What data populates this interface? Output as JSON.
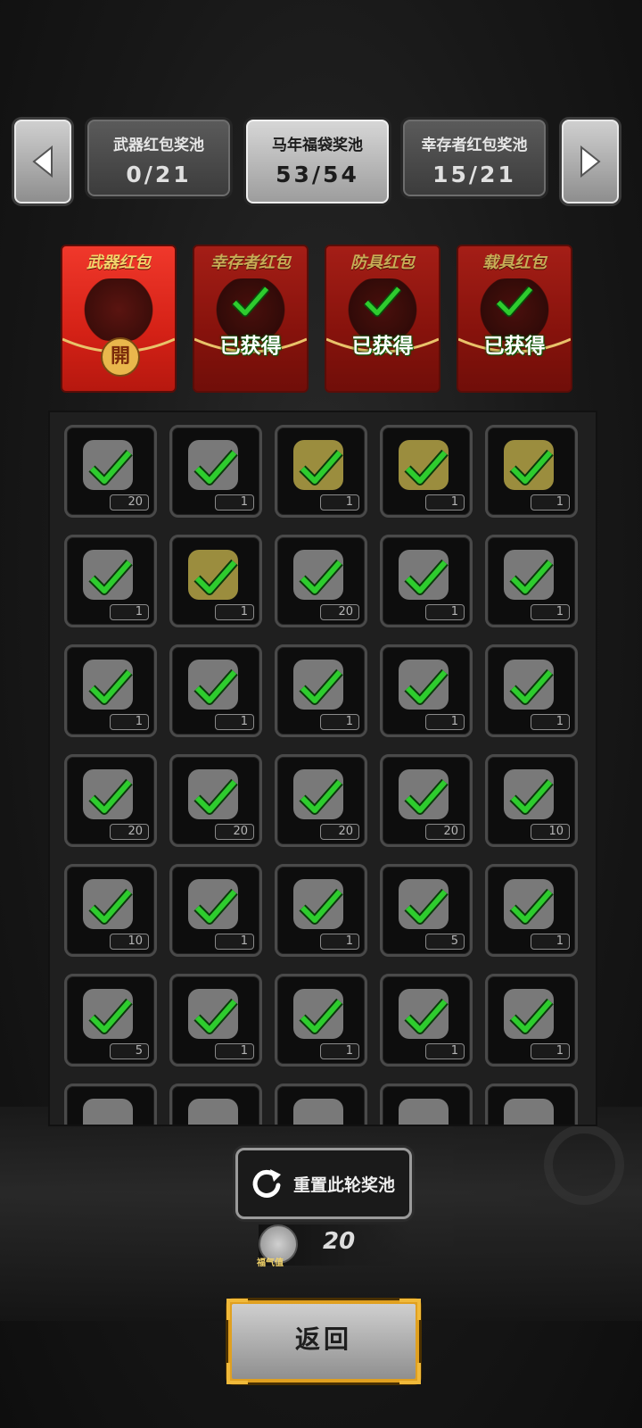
{
  "pools": {
    "tabs": [
      {
        "name": "武器红包奖池",
        "count": "0/21"
      },
      {
        "name": "马年福袋奖池",
        "count": "53/54"
      },
      {
        "name": "幸存者红包奖池",
        "count": "15/21"
      }
    ]
  },
  "envelopes": [
    {
      "title": "武器红包",
      "seal": "開",
      "status": ""
    },
    {
      "title": "幸存者红包",
      "seal": "",
      "status": "已获得"
    },
    {
      "title": "防具红包",
      "seal": "",
      "status": "已获得"
    },
    {
      "title": "载具红包",
      "seal": "",
      "status": "已获得"
    }
  ],
  "grid": {
    "rows": [
      [
        {
          "qty": "20"
        },
        {
          "qty": "1"
        },
        {
          "qty": "1",
          "gold": true
        },
        {
          "qty": "1",
          "gold": true
        },
        {
          "qty": "1",
          "gold": true
        }
      ],
      [
        {
          "qty": "1"
        },
        {
          "qty": "1",
          "gold": true
        },
        {
          "qty": "20"
        },
        {
          "qty": "1"
        },
        {
          "qty": "1"
        }
      ],
      [
        {
          "qty": "1"
        },
        {
          "qty": "1"
        },
        {
          "qty": "1"
        },
        {
          "qty": "1"
        },
        {
          "qty": "1"
        }
      ],
      [
        {
          "qty": "20"
        },
        {
          "qty": "20"
        },
        {
          "qty": "20"
        },
        {
          "qty": "20"
        },
        {
          "qty": "10"
        }
      ],
      [
        {
          "qty": "10"
        },
        {
          "qty": "1"
        },
        {
          "qty": "1"
        },
        {
          "qty": "5"
        },
        {
          "qty": "1"
        }
      ],
      [
        {
          "qty": "5"
        },
        {
          "qty": "1"
        },
        {
          "qty": "1"
        },
        {
          "qty": "1"
        },
        {
          "qty": "1"
        }
      ],
      [
        {
          "qty": ""
        },
        {
          "qty": ""
        },
        {
          "qty": ""
        },
        {
          "qty": ""
        },
        {
          "qty": ""
        }
      ]
    ]
  },
  "reset": {
    "label": "重置此轮奖池"
  },
  "luck": {
    "icon_label": "福气值",
    "value": "20"
  },
  "back": {
    "label": "返回"
  },
  "colors": {
    "check": "#2ecc2e",
    "envelope_red": "#c9251c",
    "gold_frame": "#e0a020"
  }
}
